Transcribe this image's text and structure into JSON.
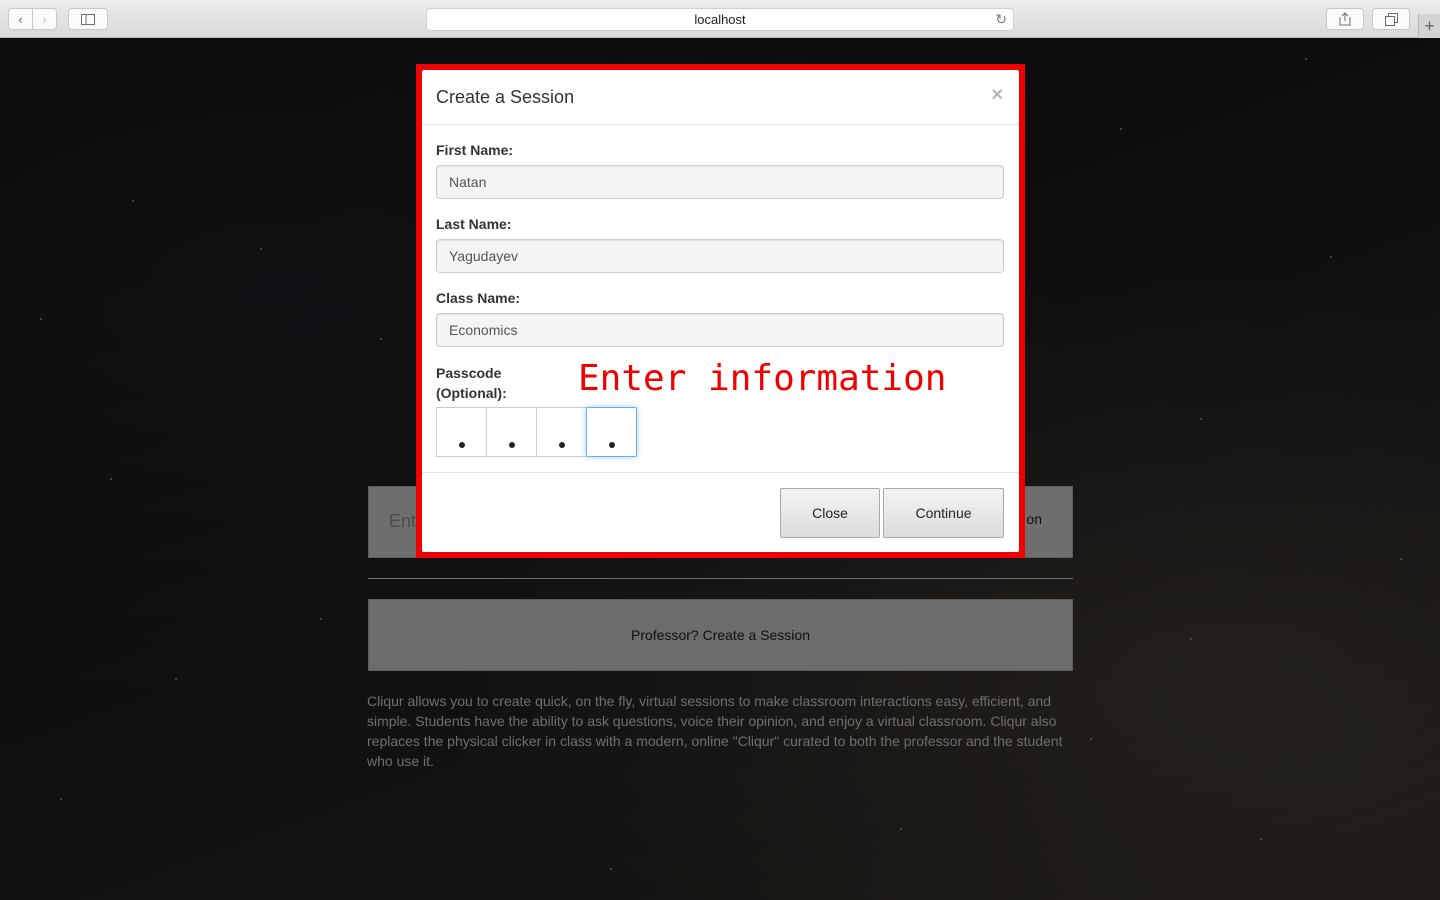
{
  "browser": {
    "url": "localhost"
  },
  "background_page": {
    "join_placeholder": "Ent",
    "join_button_partial": "on",
    "create_session_button": "Professor? Create a Session",
    "about_text": "Cliqur allows you to create quick, on the fly, virtual sessions to make classroom interactions easy, efficient, and simple. Students have the ability to ask questions, voice their opinion, and enjoy a virtual classroom. Cliqur also replaces the physical clicker in class with a modern, online \"Cliqur\" curated to both the professor and the student who use it."
  },
  "modal": {
    "title": "Create a Session",
    "close_symbol": "×",
    "fields": {
      "first_name": {
        "label": "First Name:",
        "value": "Natan"
      },
      "last_name": {
        "label": "Last Name:",
        "value": "Yagudayev"
      },
      "class_name": {
        "label": "Class Name:",
        "value": "Economics"
      }
    },
    "passcode": {
      "label_line1": "Passcode",
      "label_line2": "(Optional):",
      "digits_filled": 4
    },
    "annotation": "Enter information",
    "footer": {
      "close_label": "Close",
      "continue_label": "Continue"
    }
  },
  "colors": {
    "highlight": "#f00000",
    "annotation": "#f00000",
    "focus": "#66afe9"
  }
}
